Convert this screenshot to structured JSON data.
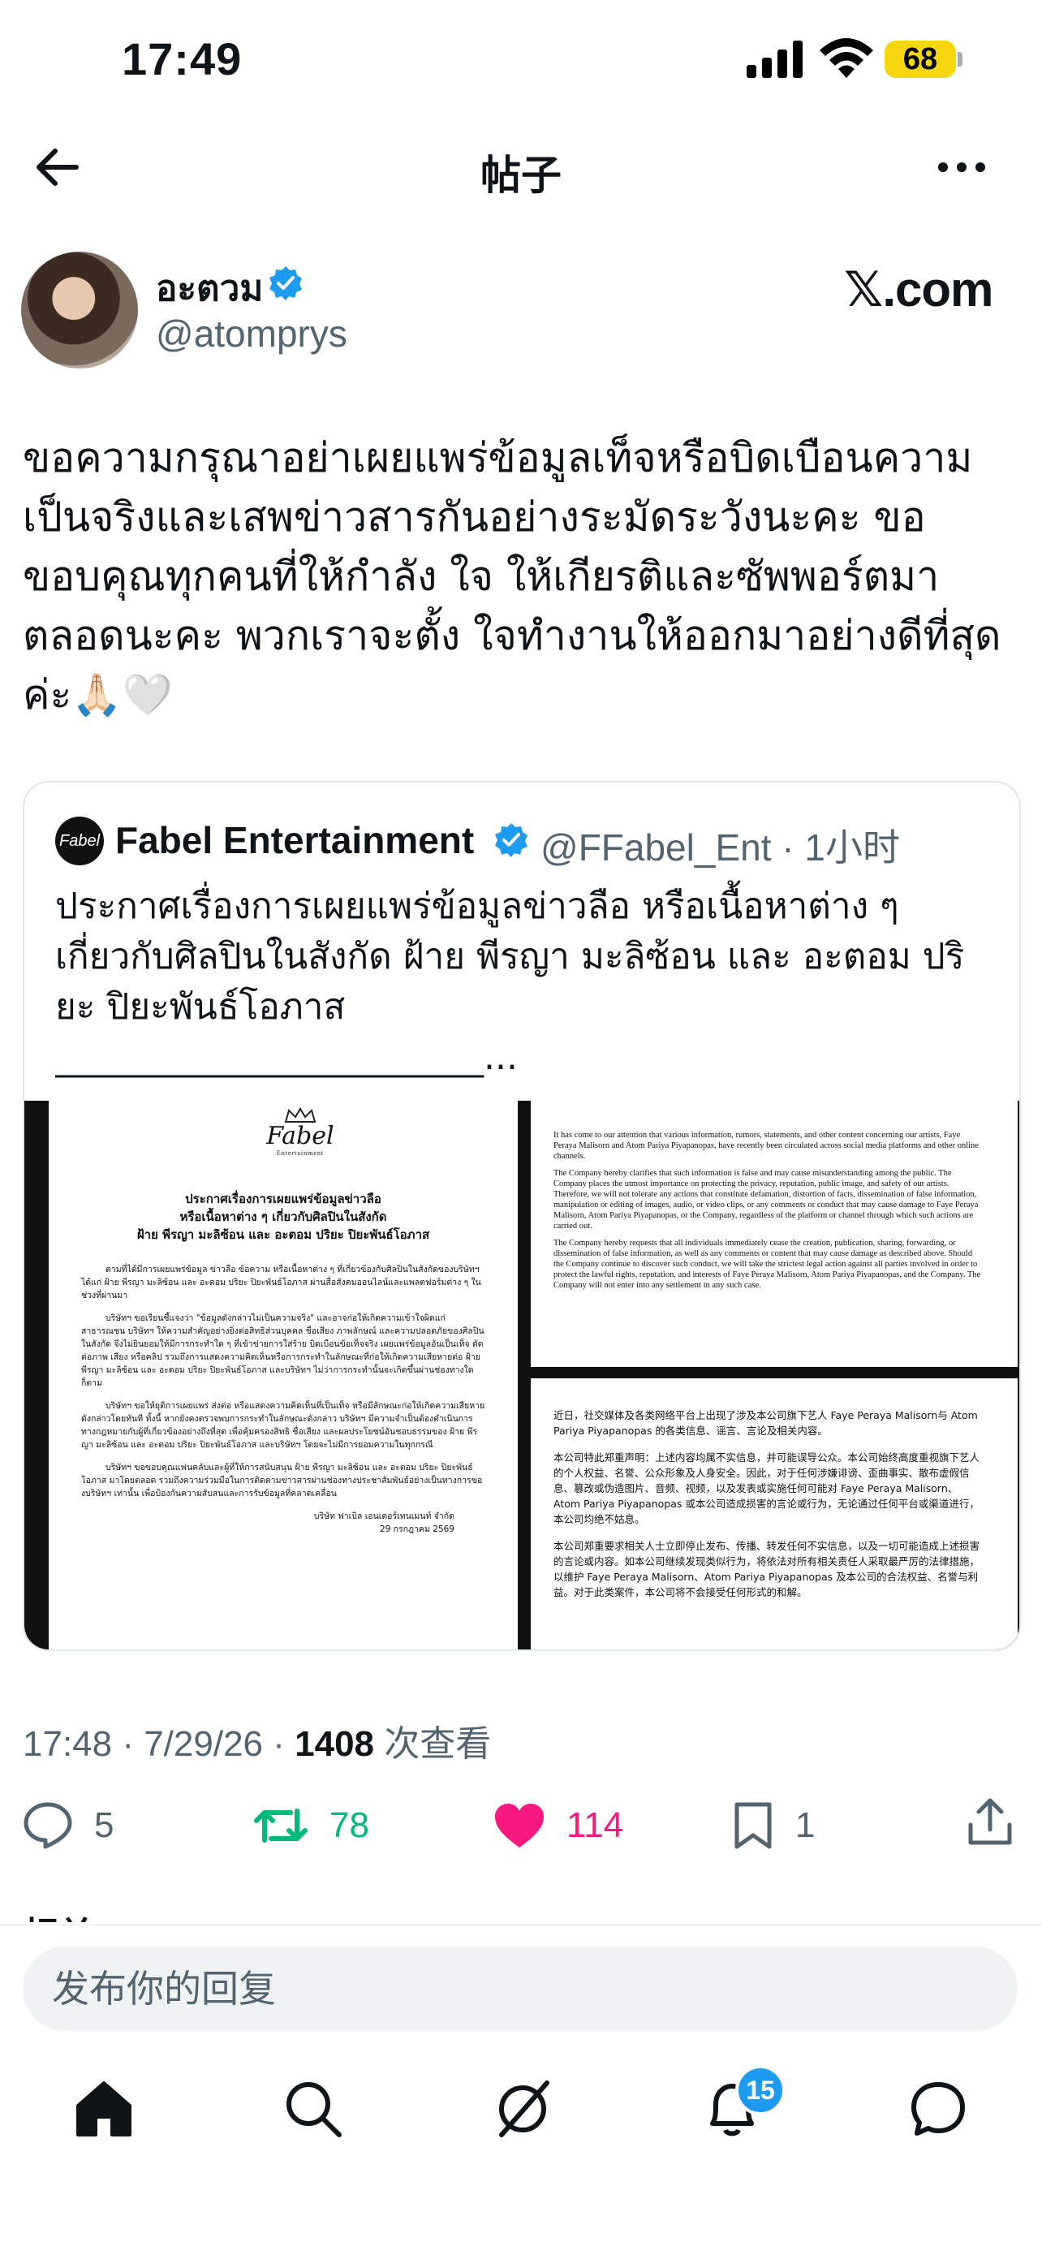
{
  "status_bar": {
    "time": "17:49",
    "battery": "68"
  },
  "nav": {
    "title": "帖子"
  },
  "author": {
    "name": "อะตวม",
    "handle": "@atomprys",
    "watermark": "𝕏.com"
  },
  "tweet": {
    "lines": [
      "ขอความกรุณาอย่าเผยแพร่ข้อมูลเท็จหรือบิดเบือนความ",
      "เป็นจริงและเสพข่าวสารกันอย่างระมัดระวังนะคะ ขอ",
      "ขอบคุณทุกคนที่ให้กำลัง ใจ ให้เกียรติและซัพพอร์ตมา",
      "ตลอดนะคะ พวกเราจะตั้ง ใจทำงานให้ออกมาอย่างดีที่สุด",
      "ค่ะ🙏🏻🤍"
    ]
  },
  "quote": {
    "avatar_text": "Fabel",
    "name": "Fabel Entertainment",
    "handle_time": "@FFabel_Ent · 1小时",
    "lines": [
      "ประกาศเรื่องการเผยแพร่ข้อมูลข่าวลือ หรือเนื้อหาต่าง ๆ",
      "เกี่ยวกับศิลปินในสังกัด ฝ้าย พีรญา มะลิซ้อน และ อะตอม ปริ",
      "ยะ ปิยะพันธ์โอภาส",
      "________________________..."
    ],
    "doc_thai": {
      "logo": "Fabel",
      "logo_sub": "Entertainment",
      "title": [
        "ประกาศเรื่องการเผยแพร่ข้อมูลข่าวลือ",
        "หรือเนื้อหาต่าง ๆ เกี่ยวกับศิลปินในสังกัด",
        "ฝ้าย พีรญา มะลิซ้อน และ อะตอม ปริยะ ปิยะพันธ์โอภาส"
      ],
      "paragraphs": [
        "ตามที่ได้มีการเผยแพร่ข้อมูล ข่าวลือ ข้อความ หรือเนื้อหาต่าง ๆ ที่เกี่ยวข้องกับศิลปินในสังกัดของบริษัทฯ ได้แก่ ฝ้าย พีรญา มะลิซ้อน และ อะตอม ปริยะ ปิยะพันธ์โอภาส ผ่านสื่อสังคมออนไลน์และแพลตฟอร์มต่าง ๆ ในช่วงที่ผ่านมา",
        "บริษัทฯ ขอเรียนชี้แจงว่า \"ข้อมูลดังกล่าวไม่เป็นความจริง\" และอาจก่อให้เกิดความเข้าใจผิดแก่สาธารณชน บริษัทฯ ให้ความสำคัญอย่างยิ่งต่อสิทธิส่วนบุคคล ชื่อเสียง ภาพลักษณ์ และความปลอดภัยของศิลปินในสังกัด จึงไม่ยินยอมให้มีการกระทำใด ๆ ที่เข้าข่ายการใส่ร้าย บิดเบือนข้อเท็จจริง เผยแพร่ข้อมูลอันเป็นเท็จ ตัดต่อภาพ เสียง หรือคลิป รวมถึงการแสดงความคิดเห็นหรือการกระทำในลักษณะที่ก่อให้เกิดความเสียหายต่อ ฝ้าย พีรญา มะลิซ้อน และ อะตอม ปริยะ ปิยะพันธ์โอภาส และบริษัทฯ ไม่ว่าการกระทำนั้นจะเกิดขึ้นผ่านช่องทางใดก็ตาม",
        "บริษัทฯ ขอให้ยุติการเผยแพร่ ส่งต่อ หรือแสดงความคิดเห็นที่เป็นเท็จ หรือมีลักษณะก่อให้เกิดความเสียหายดังกล่าวโดยทันที ทั้งนี้ หากยังคงตรวจพบการกระทำในลักษณะดังกล่าว บริษัทฯ มีความจำเป็นต้องดำเนินการทางกฎหมายกับผู้ที่เกี่ยวข้องอย่างถึงที่สุด เพื่อคุ้มครองสิทธิ ชื่อเสียง และผลประโยชน์อันชอบธรรมของ ฝ้าย พีรญา มะลิซ้อน และ อะตอม ปริยะ ปิยะพันธ์โอภาส และบริษัทฯ โดยจะไม่มีการยอมความในทุกกรณี",
        "บริษัทฯ ขอขอบคุณแฟนคลับและผู้ที่ให้การสนับสนุน ฝ้าย พีรญา มะลิซ้อน และ อะตอม ปริยะ ปิยะพันธ์โอภาส มาโดยตลอด รวมถึงความร่วมมือในการติดตามข่าวสารผ่านช่องทางประชาสัมพันธ์อย่างเป็นทางการของบริษัทฯ เท่านั้น เพื่อป้องกันความสับสนและการรับข้อมูลที่คลาดเคลื่อน"
      ],
      "signature": [
        "บริษัท ฟาเบิล เอนเตอร์เทนเมนท์ จำกัด",
        "29 กรกฎาคม 2569"
      ]
    },
    "doc_en": [
      "It has come to our attention that various information, rumors, statements, and other content concerning our artists, Faye Peraya Malisorn and Atom Pariya Piyapanopas, have recently been circulated across social media platforms and other online channels.",
      "The Company hereby clarifies that such information is false and may cause misunderstanding among the public. The Company places the utmost importance on protecting the privacy, reputation, public image, and safety of our artists.",
      "Therefore, we will not tolerate any actions that constitute defamation, distortion of facts, dissemination of false information, manipulation or editing of images, audio, or video clips, or any comments or conduct that may cause damage to Faye Peraya Malisorn, Atom Pariya Piyapanopas, or the Company, regardless of the platform or channel through which such actions are carried out.",
      "The Company hereby requests that all individuals immediately cease the creation, publication, sharing, forwarding, or dissemination of false information, as well as any comments or content that may cause damage as described above. Should the Company continue to discover such conduct, we will take the strictest legal action against all parties involved in order to protect the lawful rights, reputation, and interests of Faye Peraya Malisorn, Atom Pariya Piyapanopas, and the Company. The Company will not enter into any settlement in any such case."
    ],
    "doc_cn": [
      "近日，社交媒体及各类网络平台上出现了涉及本公司旗下艺人 Faye Peraya Malisorn与 Atom Pariya Piyapanopas 的各类信息、谣言、言论及相关内容。",
      "本公司特此郑重声明：上述内容均属不实信息，并可能误导公众。本公司始终高度重视旗下艺人的个人权益、名誉、公众形象及人身安全。因此，对于任何涉嫌诽谤、歪曲事实、散布虚假信息、篡改或伪造图片、音频、视频，以及发表或实施任何可能对 Faye Peraya Malisorn、Atom Pariya Piyapanopas 或本公司造成损害的言论或行为，无论通过任何平台或渠道进行，本公司均绝不姑息。",
      "本公司郑重要求相关人士立即停止发布、传播、转发任何不实信息，以及一切可能造成上述损害的言论或内容。如本公司继续发现类似行为，将依法对所有相关责任人采取最严厉的法律措施，以维护 Faye Peraya Malisorn、Atom Pariya Piyapanopas 及本公司的合法权益、名誉与利益。对于此类案件，本公司将不会接受任何形式的和解。"
    ]
  },
  "meta": {
    "time": "17:48 · 7/29/26 · ",
    "views": "1408",
    "views_label": " 次查看"
  },
  "actions": {
    "replies": "5",
    "reposts": "78",
    "likes": "114",
    "bookmarks": "1"
  },
  "related_label": "相关",
  "reply": {
    "placeholder": "发布你的回复"
  },
  "tabbar": {
    "notifications_badge": "15"
  },
  "colors": {
    "repost": "#00ba7c",
    "like": "#f91880",
    "verified": "#1d9bf0"
  }
}
